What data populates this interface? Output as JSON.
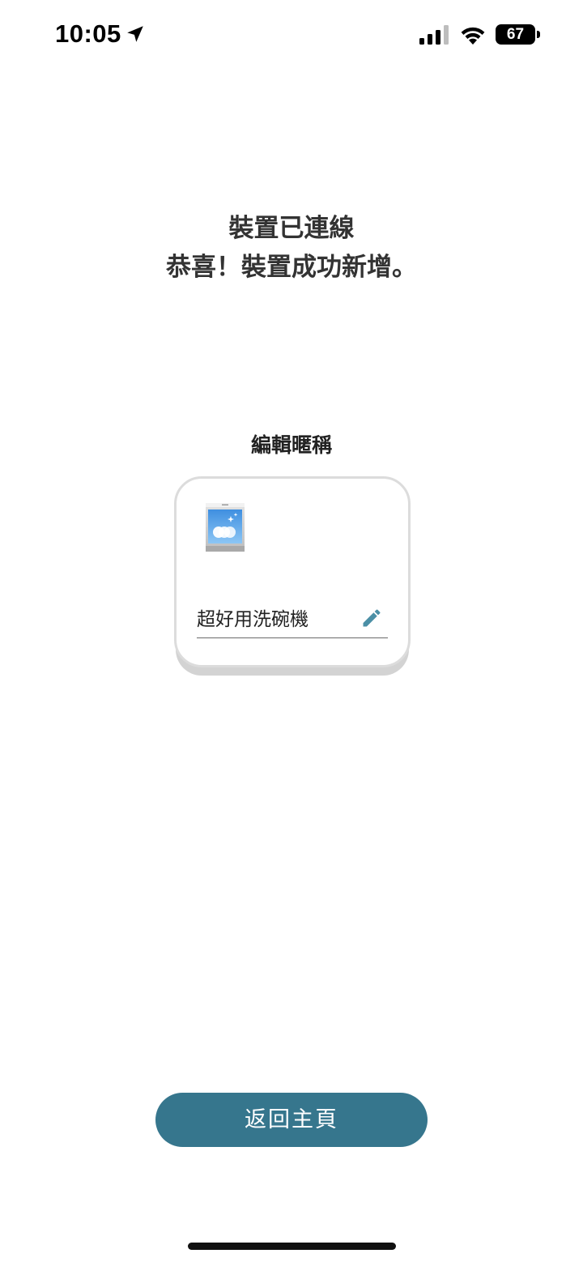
{
  "status_bar": {
    "time": "10:05",
    "battery_level": "67",
    "icons": [
      "location-arrow-icon",
      "cellular-signal-icon",
      "wifi-icon",
      "battery-icon"
    ]
  },
  "headline": {
    "line1": "裝置已連線",
    "line2": "恭喜！裝置成功新增。"
  },
  "edit_nickname": {
    "label": "編輯暱稱",
    "device_icon": "dishwasher-icon",
    "nickname_value": "超好用洗碗機",
    "edit_icon": "pencil-icon"
  },
  "actions": {
    "return_home_label": "返回主頁"
  },
  "colors": {
    "primary": "#36768d",
    "pencil": "#4b8fa6"
  }
}
